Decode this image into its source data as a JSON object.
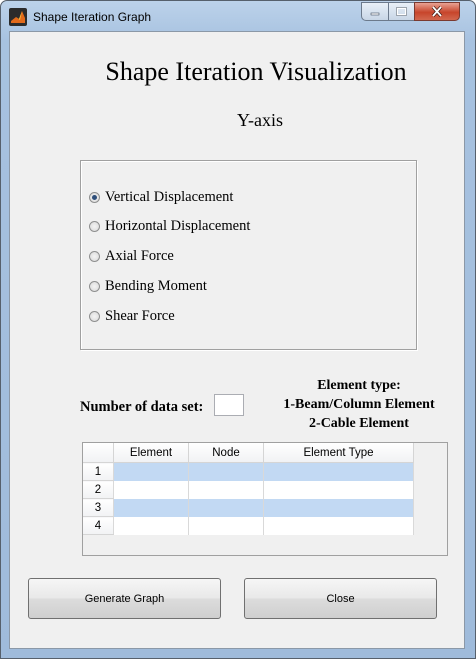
{
  "window": {
    "title": "Shape Iteration Graph",
    "controls": [
      "minimize",
      "maximize",
      "close"
    ]
  },
  "header": {
    "title": "Shape Iteration Visualization",
    "subtitle": "Y-axis"
  },
  "yaxis_options": {
    "selected": "Vertical Displacement",
    "items": [
      {
        "label": "Vertical Displacement",
        "checked": true
      },
      {
        "label": "Horizontal Displacement",
        "checked": false
      },
      {
        "label": "Axial Force",
        "checked": false
      },
      {
        "label": "Bending Moment",
        "checked": false
      },
      {
        "label": "Shear Force",
        "checked": false
      }
    ]
  },
  "dataset": {
    "label": "Number of data set:",
    "value": ""
  },
  "element_type_info": {
    "title": "Element type:",
    "line1": "1-Beam/Column Element",
    "line2": "2-Cable Element"
  },
  "table": {
    "columns": [
      "Element",
      "Node",
      "Element Type"
    ],
    "rows": [
      "1",
      "2",
      "3",
      "4"
    ]
  },
  "buttons": {
    "generate": "Generate Graph",
    "close": "Close"
  },
  "colors": {
    "selected_row": "#c2d9f3",
    "close_button": "#c7452b"
  }
}
